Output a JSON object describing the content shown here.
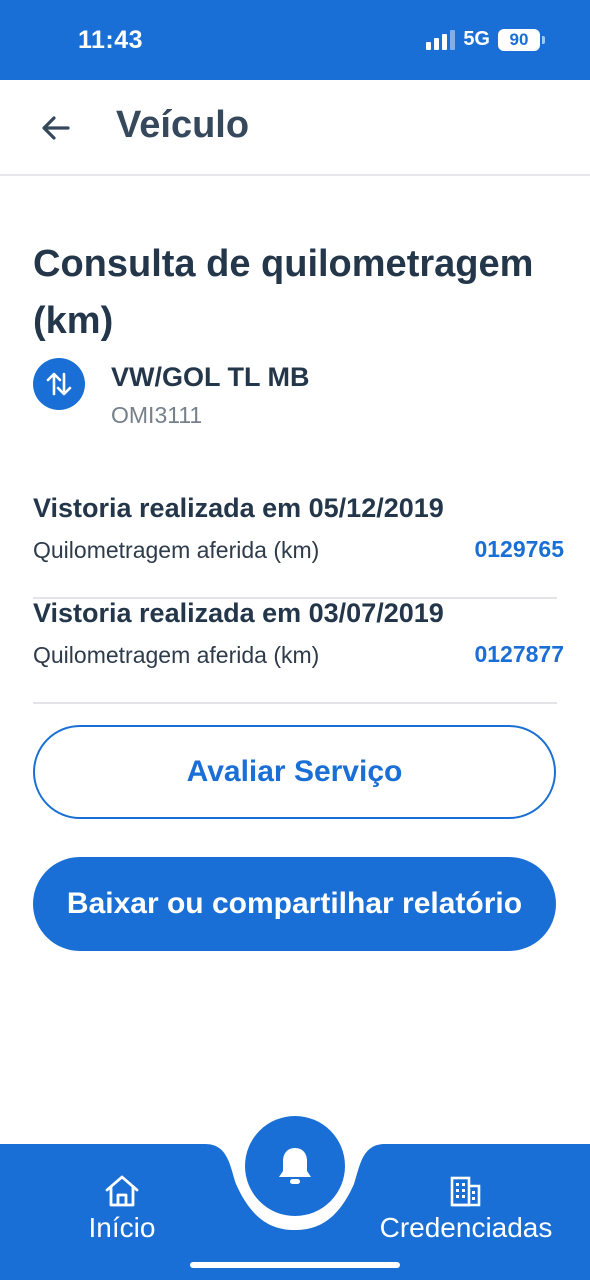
{
  "status_bar": {
    "time": "11:43",
    "network": "5G",
    "battery": "90"
  },
  "header": {
    "title": "Veículo",
    "back_icon": "arrow-left-icon"
  },
  "page_title": "Consulta de quilometragem (km)",
  "vehicle": {
    "icon": "swap-vertical-icon",
    "name": "VW/GOL TL MB",
    "plate": "OMI3111"
  },
  "inspections": [
    {
      "date_label": "Vistoria realizada em 05/12/2019",
      "mileage_label": "Quilometragem aferida (km)",
      "mileage_value": "0129765"
    },
    {
      "date_label": "Vistoria realizada em 03/07/2019",
      "mileage_label": "Quilometragem aferida (km)",
      "mileage_value": "0127877"
    }
  ],
  "actions": {
    "rate_label": "Avaliar Serviço",
    "download_label": "Baixar ou compartilhar relatório"
  },
  "bottom_nav": {
    "home_label": "Início",
    "home_icon": "home-icon",
    "fab_icon": "bell-icon",
    "accredited_label": "Credenciadas",
    "accredited_icon": "building-icon"
  },
  "colors": {
    "primary": "#1a6fd6",
    "text": "#23364a",
    "muted": "#76808b"
  }
}
